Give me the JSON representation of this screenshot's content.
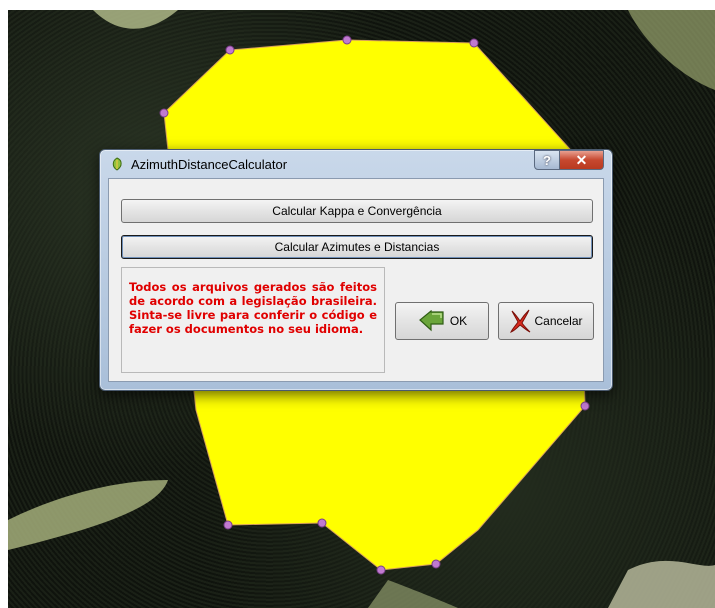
{
  "window": {
    "title": "AzimuthDistanceCalculator",
    "help_glyph": "?",
    "close_glyph": "✕"
  },
  "buttons": {
    "kappa": "Calcular Kappa e Convergência",
    "azimutes": "Calcular Azimutes e Distancias",
    "ok": "OK",
    "cancel": "Cancelar"
  },
  "note": "Todos os arquivos gerados são feitos de acordo com a legislação brasileira. Sinta-se livre para conferir o código e fazer os documentos no seu idioma.",
  "colors": {
    "polygon_fill": "#ffff00",
    "vertex": "#c07ad0",
    "note_text": "#e00000"
  },
  "icons": {
    "app": "qgis-leaf-icon",
    "ok": "green-arrow-icon",
    "cancel": "red-x-icon"
  }
}
